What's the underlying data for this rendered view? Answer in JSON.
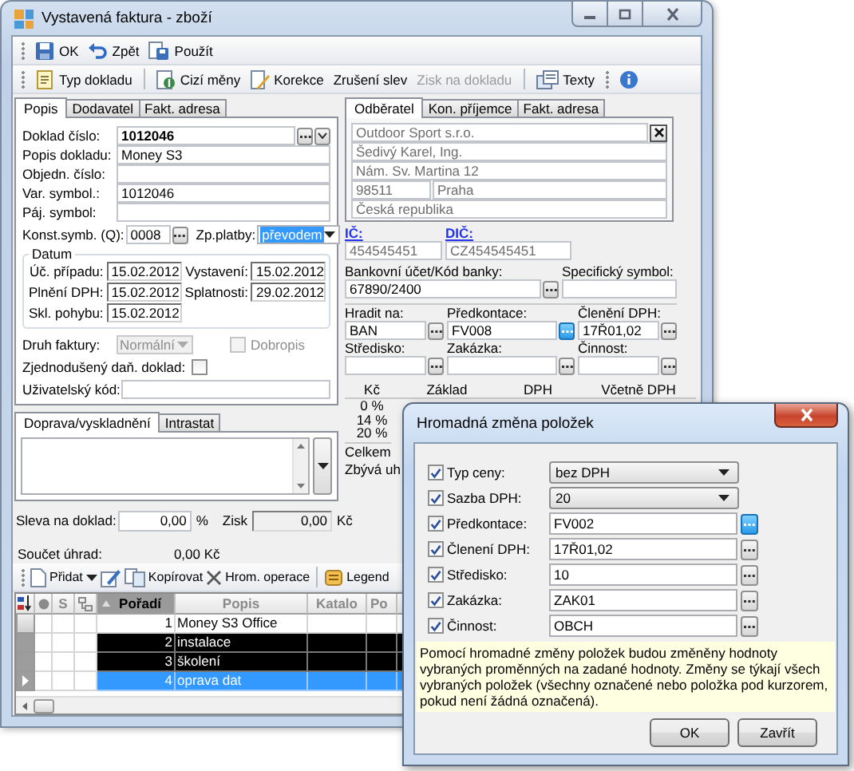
{
  "window": {
    "title": "Vystavená faktura - zboží"
  },
  "toolbar": [
    {
      "label": "OK"
    },
    {
      "label": "Zpět"
    },
    {
      "label": "Použít"
    }
  ],
  "toolbar2": {
    "groups": [
      [
        {
          "kind": "icon-text",
          "label": "Typ dokladu",
          "disabled": false
        }
      ],
      [
        {
          "kind": "icon-text",
          "label": "Cizí měny",
          "disabled": false
        },
        {
          "kind": "icon-text",
          "label": "Korekce",
          "disabled": false
        },
        {
          "kind": "text",
          "label": "Zrušení slev",
          "disabled": false
        },
        {
          "kind": "text",
          "label": "Zisk na dokladu",
          "disabled": true
        }
      ],
      [
        {
          "kind": "icon-text",
          "label": "Texty",
          "disabled": false
        }
      ]
    ]
  },
  "left_tabs": [
    {
      "label": "Popis",
      "selected": true
    },
    {
      "label": "Dodavatel",
      "selected": false
    },
    {
      "label": "Fakt. adresa",
      "selected": false
    }
  ],
  "header_fields": [
    {
      "kind": "lookup",
      "label": "Doklad číslo:",
      "value": "1012046"
    },
    {
      "kind": "text",
      "label": "Popis dokladu:",
      "value": "Money S3"
    },
    {
      "kind": "text",
      "label": "Objedn. číslo:"
    },
    {
      "kind": "text",
      "label": "Var. symbol.:",
      "value": "1012046"
    },
    {
      "kind": "text",
      "label": "Páj. symbol:"
    }
  ],
  "constant_symbol": {
    "label": "Konst.symb. (Q):",
    "value": "0008"
  },
  "payment_method": {
    "label": "Zp.platby:",
    "value": "převodem"
  },
  "dates": {
    "title": "Datum",
    "items": [
      {
        "label": "Úč. případu:",
        "value": "15.02.2012"
      },
      {
        "label": "Vystavení:",
        "value": "15.02.2012"
      },
      {
        "label": "Plnění DPH:",
        "value": "15.02.2012"
      },
      {
        "label": "Splatnosti:",
        "value": "29.02.2012"
      },
      {
        "label": "Skl. pohybu:",
        "value": "15.02.2012"
      }
    ]
  },
  "invoice_type": {
    "label": "Druh faktury:",
    "value": "Normální",
    "disabled": true
  },
  "credit_note": {
    "label": "Dobropis",
    "checked": false,
    "disabled": true
  },
  "simplified_doc": {
    "label": "Zjednodušený daň. doklad:",
    "checked": false
  },
  "user_code": {
    "label": "Uživatelský kód:"
  },
  "bottom_tabs": [
    {
      "label": "Doprava/vyskladnění",
      "selected": true
    },
    {
      "label": "Intrastat",
      "selected": false
    }
  ],
  "discount": {
    "label": "Sleva na doklad:",
    "value": "0,00",
    "unit": "%"
  },
  "profit": {
    "label": "Zisk",
    "value": "0,00",
    "unit": "Kč"
  },
  "payments_total": {
    "label": "Součet úhrad:",
    "value": "0,00 Kč"
  },
  "items_toolbar": [
    {
      "kind": "dropdown",
      "label": "Přidat"
    },
    {
      "kind": "icon"
    },
    {
      "kind": "button",
      "label": "Kopírovat"
    },
    {
      "kind": "icon"
    },
    {
      "kind": "text",
      "label": "Hrom. operace"
    },
    {
      "kind": "button",
      "label": "Legend",
      "group_start": true
    }
  ],
  "items_grid": {
    "columns": [
      {
        "kind": "sort"
      },
      {
        "kind": "icon"
      },
      {
        "kind": "text",
        "label": "S",
        "sorted": false
      },
      {
        "kind": "icon"
      },
      {
        "kind": "text",
        "label": "Pořadí",
        "sorted": true
      },
      {
        "kind": "text",
        "label": "Popis",
        "sorted": false
      },
      {
        "kind": "text",
        "label": "Katalo",
        "sorted": false
      },
      {
        "kind": "text",
        "label": "Po",
        "sorted": false
      }
    ],
    "rows": [
      {
        "order": "1",
        "description": "Money S3 Office",
        "marked": false,
        "selected": false
      },
      {
        "order": "2",
        "description": "instalace",
        "marked": true,
        "selected": false
      },
      {
        "order": "3",
        "description": "školení",
        "marked": true,
        "selected": false
      },
      {
        "order": "4",
        "description": "oprava dat",
        "marked": false,
        "selected": true
      }
    ]
  },
  "customer_tabs": [
    {
      "label": "Odběratel",
      "selected": true
    },
    {
      "label": "Kon. příjemce",
      "selected": false
    },
    {
      "label": "Fakt. adresa",
      "selected": false
    }
  ],
  "customer": {
    "company": "Outdoor Sport s.r.o.",
    "contact": "Šedivý Karel, Ing.",
    "street": "Nám. Sv. Martina 12",
    "zip": "98511",
    "city": "Praha",
    "country": "Česká republika"
  },
  "tax_ids": [
    {
      "label": "IČ:",
      "value": "454545451"
    },
    {
      "label": "DIČ:",
      "value": "CZ454545451"
    }
  ],
  "bank_account": {
    "label": "Bankovní účet/Kód banky:",
    "value": "67890/2400"
  },
  "specific_symbol": {
    "label": "Specifický symbol:"
  },
  "accounting": [
    {
      "label": "Hradit na:",
      "value": "BAN",
      "focused": false
    },
    {
      "label": "Předkontace:",
      "value": "FV008",
      "focused": true
    },
    {
      "label": "Členění DPH:",
      "value": "17Ř01,02",
      "focused": false
    },
    {
      "label": "Středisko:",
      "focused": false
    },
    {
      "label": "Zakázka:",
      "focused": false
    },
    {
      "label": "Činnost:",
      "focused": false
    }
  ],
  "vat_summary": {
    "columns": [
      "Kč",
      "Základ",
      "DPH",
      "Včetně DPH"
    ],
    "rows": [
      "0 %",
      "14 %",
      "20 %",
      "Celkem",
      "Zbývá uh"
    ]
  },
  "dialog": {
    "title": "Hromadná změna položek",
    "fields": [
      {
        "kind": "combo",
        "label": "Typ ceny:",
        "value": "bez DPH",
        "checked": true
      },
      {
        "kind": "combo",
        "label": "Sazba DPH:",
        "value": "20",
        "checked": true
      },
      {
        "kind": "lookup",
        "label": "Předkontace:",
        "value": "FV002",
        "checked": true,
        "focused": true
      },
      {
        "kind": "lookup",
        "label": "Členení DPH:",
        "value": "17Ř01,02",
        "checked": true,
        "focused": false
      },
      {
        "kind": "lookup",
        "label": "Středisko:",
        "value": "10",
        "checked": true,
        "focused": false
      },
      {
        "kind": "lookup",
        "label": "Zakázka:",
        "value": "ZAK01",
        "checked": true,
        "focused": false
      },
      {
        "kind": "lookup",
        "label": "Činnost:",
        "value": "OBCH",
        "checked": true,
        "focused": false
      }
    ],
    "note": "Pomocí hromadné změny položek budou změněny hodnoty vybraných proměnných na zadané hodnoty. Změny se týkají všech vybraných položek (všechny označené nebo položka pod kurzorem, pokud není žádná označená).",
    "buttons": [
      "OK",
      "Zavřít"
    ]
  }
}
